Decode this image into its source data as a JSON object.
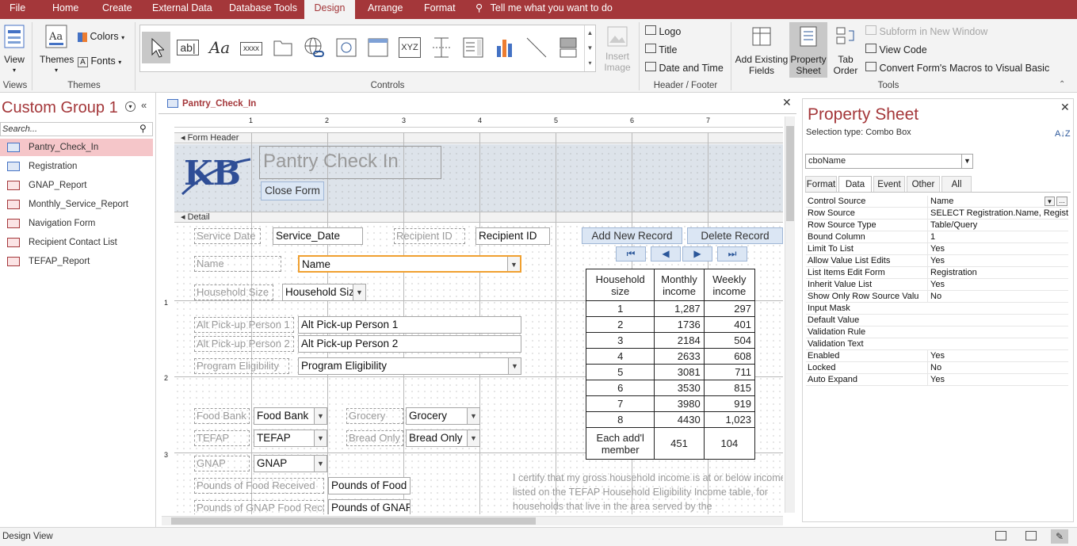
{
  "menubar": {
    "items": [
      "File",
      "Home",
      "Create",
      "External Data",
      "Database Tools",
      "Design",
      "Arrange",
      "Format"
    ],
    "active": "Design",
    "tellme": "Tell me what you want to do"
  },
  "ribbon": {
    "views": {
      "view": "View",
      "group": "Views"
    },
    "themes": {
      "themes": "Themes",
      "colors": "Colors",
      "fonts": "Fonts",
      "group": "Themes"
    },
    "controls": {
      "group": "Controls",
      "textbox": "ab|",
      "label": "Aa",
      "xxxx": "xxxx",
      "xyz": "XYZ",
      "insert_image": "Insert Image"
    },
    "header_footer": {
      "logo": "Logo",
      "title": "Title",
      "datetime": "Date and Time",
      "group": "Header / Footer"
    },
    "tools": {
      "add_fields": "Add Existing Fields",
      "property_sheet": "Property Sheet",
      "tab_order": "Tab Order",
      "subform": "Subform in New Window",
      "view_code": "View Code",
      "convert": "Convert Form's Macros to Visual Basic",
      "group": "Tools"
    }
  },
  "nav": {
    "title": "Custom Group 1",
    "search_placeholder": "Search...",
    "items": [
      {
        "label": "Pantry_Check_In",
        "type": "form",
        "selected": true
      },
      {
        "label": "Registration",
        "type": "form"
      },
      {
        "label": "GNAP_Report",
        "type": "report"
      },
      {
        "label": "Monthly_Service_Report",
        "type": "report"
      },
      {
        "label": "Navigation Form",
        "type": "report"
      },
      {
        "label": "Recipient Contact List",
        "type": "report"
      },
      {
        "label": "TEFAP_Report",
        "type": "report"
      }
    ]
  },
  "doc": {
    "tab": "Pantry_Check_In",
    "ruler_numbers": [
      "1",
      "2",
      "3",
      "4",
      "5",
      "6",
      "7"
    ],
    "vruler_numbers": [
      "1",
      "2",
      "3"
    ],
    "form_header": "Form Header",
    "detail": "Detail",
    "logo_text": "KB",
    "title": "Pantry Check In",
    "close_form": "Close Form",
    "labels": {
      "service_date": "Service  Date",
      "recipient_id": "Recipient ID",
      "name": "Name",
      "household_size": "Household Size",
      "alt1": "Alt Pick-up Person 1",
      "alt2": "Alt Pick-up Person 2",
      "program_eligibility": "Program Eligibility",
      "food_bank": "Food Bank",
      "grocery": "Grocery",
      "tefap": "TEFAP",
      "bread_only": "Bread Only",
      "gnap": "GNAP",
      "pounds_food": "Pounds of Food Received",
      "pounds_gnap": "Pounds of GNAP Food Rece"
    },
    "fields": {
      "service_date": "Service_Date",
      "recipient_id": "Recipient ID",
      "name": "Name",
      "household_size": "Household Siz",
      "alt1": "Alt Pick-up Person 1",
      "alt2": "Alt Pick-up Person 2",
      "program_eligibility": "Program Eligibility",
      "food_bank": "Food Bank",
      "grocery": "Grocery",
      "tefap": "TEFAP",
      "bread_only": "Bread Only",
      "gnap": "GNAP",
      "pounds_food": "Pounds of Food",
      "pounds_gnap": "Pounds of GNAP"
    },
    "buttons": {
      "add_new": "Add New Record",
      "delete": "Delete Record"
    },
    "income_table": {
      "headers": [
        "Household size",
        "Monthly income",
        "Weekly income"
      ],
      "rows": [
        [
          "1",
          "1,287",
          "297"
        ],
        [
          "2",
          "1736",
          "401"
        ],
        [
          "3",
          "2184",
          "504"
        ],
        [
          "4",
          "2633",
          "608"
        ],
        [
          "5",
          "3081",
          "711"
        ],
        [
          "6",
          "3530",
          "815"
        ],
        [
          "7",
          "3980",
          "919"
        ],
        [
          "8",
          "4430",
          "1,023"
        ],
        [
          "Each add'l member",
          "451",
          "104"
        ]
      ]
    },
    "certify_text": "I certify that my gross household income is at or below income listed on the TEFAP Household Eligibility Income table, for households that live in the area served by the"
  },
  "props": {
    "title": "Property Sheet",
    "selection_type": "Selection type:  Combo Box",
    "object": "cboName",
    "tabs": [
      "Format",
      "Data",
      "Event",
      "Other",
      "All"
    ],
    "active_tab": "Data",
    "rows": [
      {
        "name": "Control Source",
        "value": "Name"
      },
      {
        "name": "Row Source",
        "value": "SELECT Registration.Name, Registr"
      },
      {
        "name": "Row Source Type",
        "value": "Table/Query"
      },
      {
        "name": "Bound Column",
        "value": "1"
      },
      {
        "name": "Limit To List",
        "value": "Yes"
      },
      {
        "name": "Allow Value List Edits",
        "value": "Yes"
      },
      {
        "name": "List Items Edit Form",
        "value": "Registration"
      },
      {
        "name": "Inherit Value List",
        "value": "Yes"
      },
      {
        "name": "Show Only Row Source Valu",
        "value": "No"
      },
      {
        "name": "Input Mask",
        "value": ""
      },
      {
        "name": "Default Value",
        "value": ""
      },
      {
        "name": "Validation Rule",
        "value": ""
      },
      {
        "name": "Validation Text",
        "value": ""
      },
      {
        "name": "Enabled",
        "value": "Yes"
      },
      {
        "name": "Locked",
        "value": "No"
      },
      {
        "name": "Auto Expand",
        "value": "Yes"
      }
    ]
  },
  "status": {
    "text": "Design View"
  }
}
